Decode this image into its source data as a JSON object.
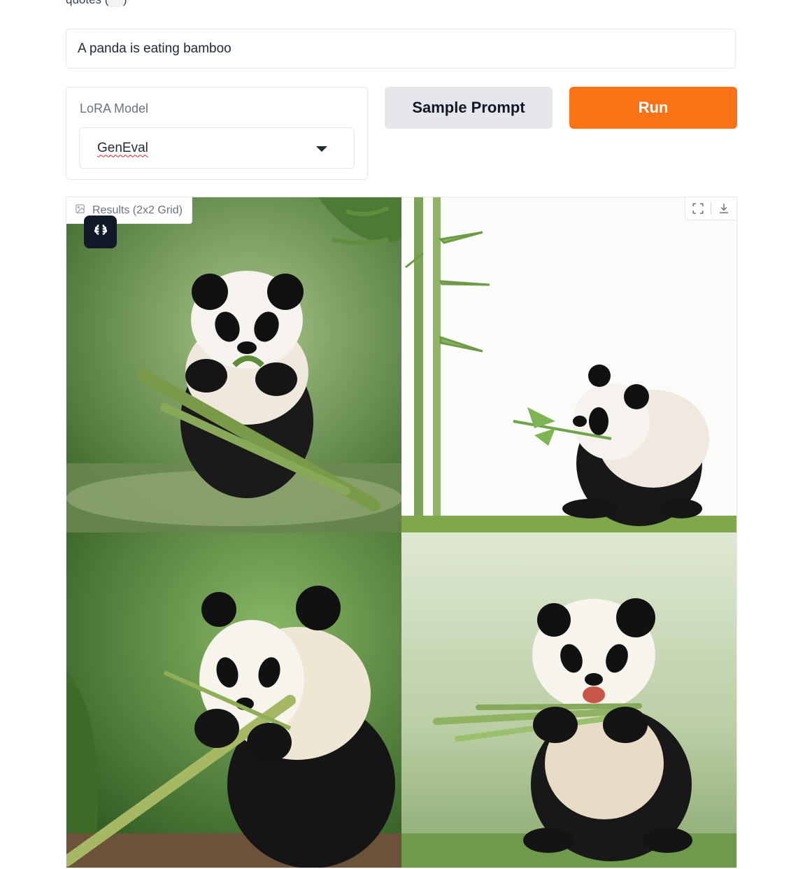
{
  "header": {
    "note_prefix": "quotes (",
    "note_code": "\"",
    "note_suffix": ")"
  },
  "prompt": {
    "value": "A panda is eating bamboo"
  },
  "lora": {
    "label": "LoRA Model",
    "selected": "GenEval"
  },
  "buttons": {
    "sample_label": "Sample Prompt",
    "run_label": "Run"
  },
  "results": {
    "label": "Results (2x2 Grid)",
    "images": [
      {
        "name": "panda-eating-bamboo-forest-stream"
      },
      {
        "name": "panda-eating-bamboo-white-background"
      },
      {
        "name": "panda-holding-bamboo-green-forest"
      },
      {
        "name": "panda-laughing-bamboo-misty-water"
      }
    ]
  },
  "icons": {
    "image": "image-icon",
    "brain": "brain-icon",
    "fullscreen": "fullscreen-icon",
    "download": "download-icon",
    "caret": "chevron-down-icon"
  },
  "colors": {
    "accent": "#f97316",
    "secondary_button": "#e5e7eb",
    "dark_badge": "#111827"
  }
}
